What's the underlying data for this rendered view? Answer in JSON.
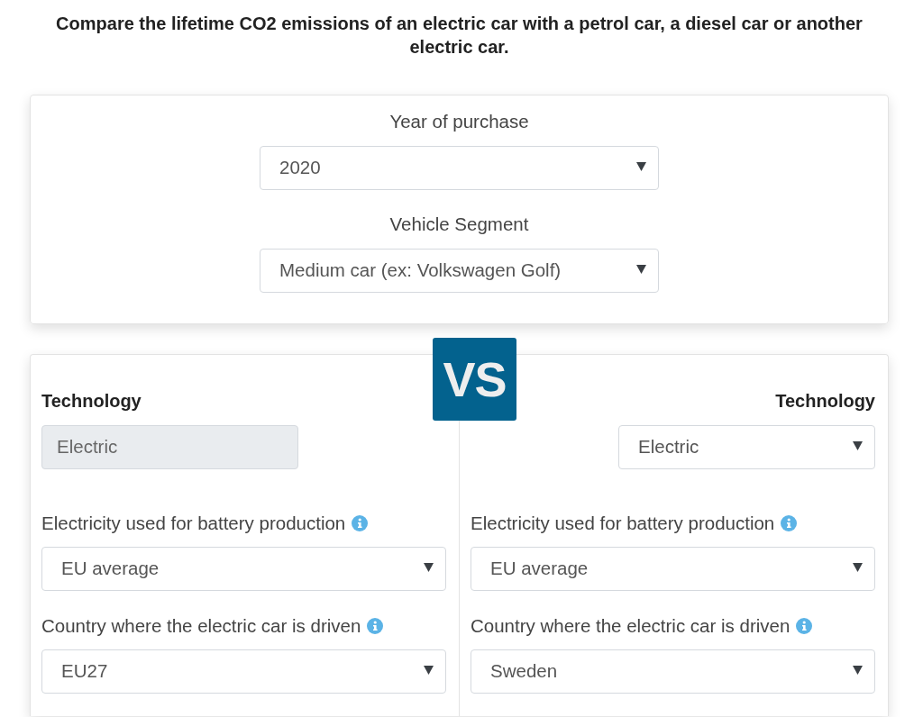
{
  "intro": "Compare the lifetime CO2 emissions of an electric car with a petrol car, a diesel car or another electric car.",
  "general": {
    "fields": [
      {
        "label": "Year of purchase",
        "value": "2020"
      },
      {
        "label": "Vehicle Segment",
        "value": "Medium car (ex: Volkswagen Golf)"
      }
    ]
  },
  "vs_badge": "VS",
  "cars": [
    {
      "heading": "Technology",
      "technology": {
        "value": "Electric",
        "disabled": true
      },
      "fields": [
        {
          "label": "Electricity used for battery production",
          "info": true,
          "value": "EU average"
        },
        {
          "label": "Country where the electric car is driven",
          "info": true,
          "value": "EU27"
        }
      ]
    },
    {
      "heading": "Technology",
      "technology": {
        "value": "Electric",
        "disabled": false
      },
      "fields": [
        {
          "label": "Electricity used for battery production",
          "info": true,
          "value": "EU average"
        },
        {
          "label": "Country where the electric car is driven",
          "info": true,
          "value": "Sweden"
        }
      ]
    }
  ]
}
